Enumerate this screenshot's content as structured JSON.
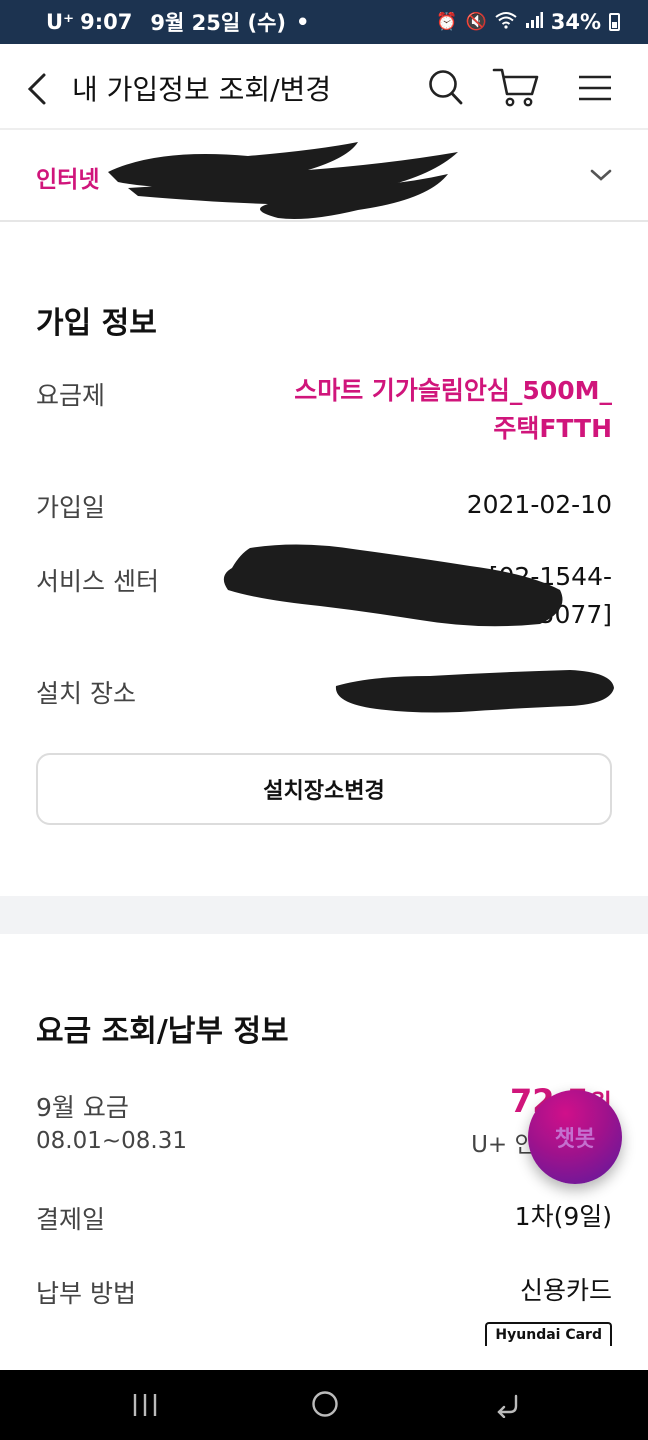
{
  "status_bar": {
    "carrier": "U⁺",
    "time": "9:07",
    "date": "9월 25일 (수)",
    "dot": "•",
    "battery": "34%"
  },
  "header": {
    "title": "내 가입정보 조회/변경"
  },
  "product_selector": {
    "label": "인터넷"
  },
  "subscription": {
    "title": "가입 정보",
    "plan_label": "요금제",
    "plan_value_line1": "스마트 기가슬림안심_500M_",
    "plan_value_line2": "주택FTTH",
    "join_date_label": "가입일",
    "join_date_value": "2021-02-10",
    "service_center_label": "서비스 센터",
    "service_center_partial_line1": "[02-1544-",
    "service_center_partial_line2": "5077]",
    "install_location_label": "설치 장소",
    "change_location_button": "설치장소변경"
  },
  "billing": {
    "title": "요금 조회/납부 정보",
    "month_label": "9월 요금",
    "period": "08.01~08.31",
    "amount_partial": "72.5",
    "amount_suffix": "원",
    "service_partial": "U+ 인터넷",
    "payment_day_label": "결제일",
    "payment_day_value": "1차(9일)",
    "payment_method_label": "납부 방법",
    "payment_method_value": "신용카드",
    "card_brand": "Hyundai Card"
  },
  "chatbot": {
    "label": "챗봇"
  },
  "colors": {
    "accent_pink": "#d0157b",
    "status_bar_bg": "#1c3350",
    "section_divider": "#f2f3f5"
  }
}
